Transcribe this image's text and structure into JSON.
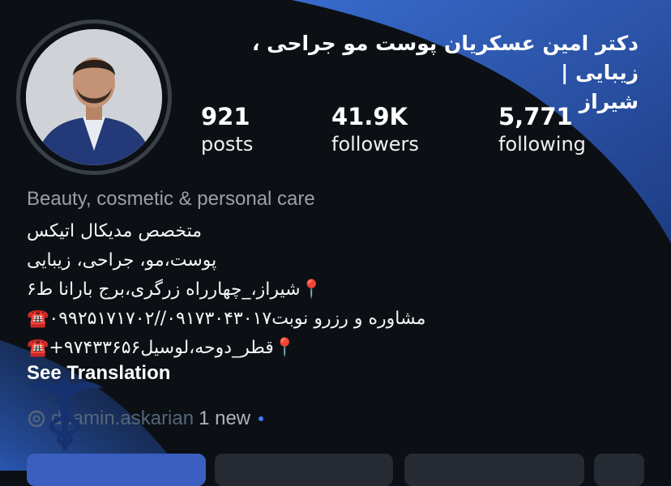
{
  "profile": {
    "name_line1": "دکتر امین عسکریان پوست مو جراحی ، زیبایی |",
    "name_line2": "شیراز",
    "category": "Beauty, cosmetic & personal care",
    "handle": "dr.amin.askarian",
    "threads_status": "1 new"
  },
  "stats": [
    {
      "value": "921",
      "label": "posts"
    },
    {
      "value": "41.9K",
      "label": "followers"
    },
    {
      "value": "5,771",
      "label": "following"
    }
  ],
  "bio": {
    "line1": "متخصص مدیکال اتیکس",
    "line2": "پوست،مو، جراحی، زیبایی",
    "line3": "📍شیراز،_چهارراه زرگری،برج بارانا ط۶",
    "line4": "مشاوره و رزرو نوبت۰۹۱۷۳۰۴۳۰۱۷//۰۹۹۲۵۱۷۱۷۰۲☎️",
    "line5": "📍قطر_دوحه،لوسیل۹۷۴۳۳۶۵۶+☎️"
  },
  "actions": {
    "see_translation": "See Translation"
  },
  "icons": {
    "threads": "threads-icon",
    "caduceus": "caduceus-icon"
  },
  "colors": {
    "background": "#0c1015",
    "accent_blue": "#3a6fd0",
    "unread_dot": "#3d7bff"
  }
}
